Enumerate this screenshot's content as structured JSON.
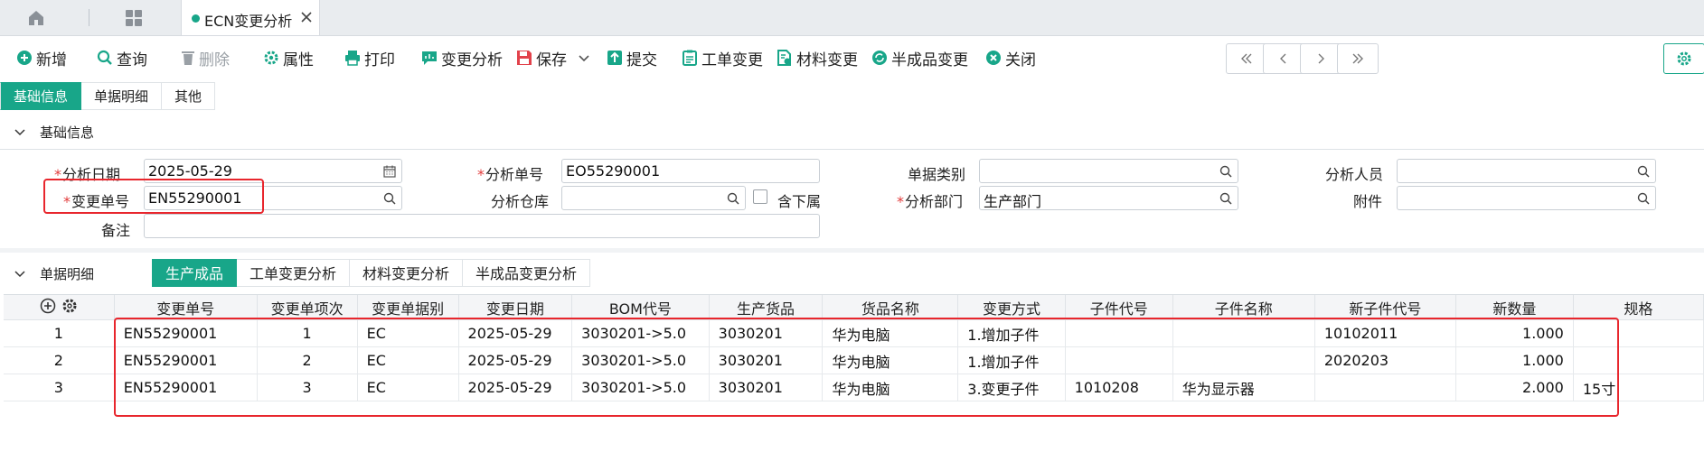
{
  "tabbar": {
    "active_tab": "ECN变更分析"
  },
  "toolbar": {
    "new": "新增",
    "query": "查询",
    "delete": "删除",
    "properties": "属性",
    "print": "打印",
    "change_analysis": "变更分析",
    "save": "保存",
    "submit": "提交",
    "work_order_change": "工单变更",
    "material_change": "材料变更",
    "semi_finished_change": "半成品变更",
    "close": "关闭"
  },
  "section_tabs": [
    "基础信息",
    "单据明细",
    "其他"
  ],
  "basic_info": {
    "title": "基础信息",
    "labels": {
      "analysis_date": "分析日期",
      "change_no": "变更单号",
      "remark": "备注",
      "analysis_no": "分析单号",
      "analysis_warehouse": "分析仓库",
      "include_sub": "含下属",
      "doc_category": "单据类别",
      "analysis_dept": "分析部门",
      "analyst": "分析人员",
      "attachment": "附件"
    },
    "values": {
      "analysis_date": "2025-05-29",
      "change_no": "EN55290001",
      "remark": "",
      "analysis_no": "EO55290001",
      "analysis_warehouse": "",
      "doc_category": "",
      "analysis_dept": "生产部门",
      "analyst": "",
      "attachment": ""
    }
  },
  "detail": {
    "title": "单据明细",
    "tabs": [
      "生产成品",
      "工单变更分析",
      "材料变更分析",
      "半成品变更分析"
    ],
    "columns": [
      "变更单号",
      "变更单项次",
      "变更单据别",
      "变更日期",
      "BOM代号",
      "生产货品",
      "货品名称",
      "变更方式",
      "子件代号",
      "子件名称",
      "新子件代号",
      "新数量",
      "规格"
    ],
    "rows": [
      {
        "no": "1",
        "change_no": "EN55290001",
        "seq": "1",
        "doc_type": "EC",
        "date": "2025-05-29",
        "bom": "3030201->5.0",
        "product": "3030201",
        "product_name": "华为电脑",
        "method": "1.增加子件",
        "child_code": "",
        "child_name": "",
        "new_child_code": "10102011",
        "new_qty": "1.000",
        "spec": ""
      },
      {
        "no": "2",
        "change_no": "EN55290001",
        "seq": "2",
        "doc_type": "EC",
        "date": "2025-05-29",
        "bom": "3030201->5.0",
        "product": "3030201",
        "product_name": "华为电脑",
        "method": "1.增加子件",
        "child_code": "",
        "child_name": "",
        "new_child_code": "2020203",
        "new_qty": "1.000",
        "spec": ""
      },
      {
        "no": "3",
        "change_no": "EN55290001",
        "seq": "3",
        "doc_type": "EC",
        "date": "2025-05-29",
        "bom": "3030201->5.0",
        "product": "3030201",
        "product_name": "华为电脑",
        "method": "3.变更子件",
        "child_code": "1010208",
        "child_name": "华为显示器",
        "new_child_code": "",
        "new_qty": "2.000",
        "spec": "15寸"
      }
    ]
  },
  "colors": {
    "accent": "#18a689",
    "highlight": "#e8262d",
    "required": "#e23b3b"
  }
}
